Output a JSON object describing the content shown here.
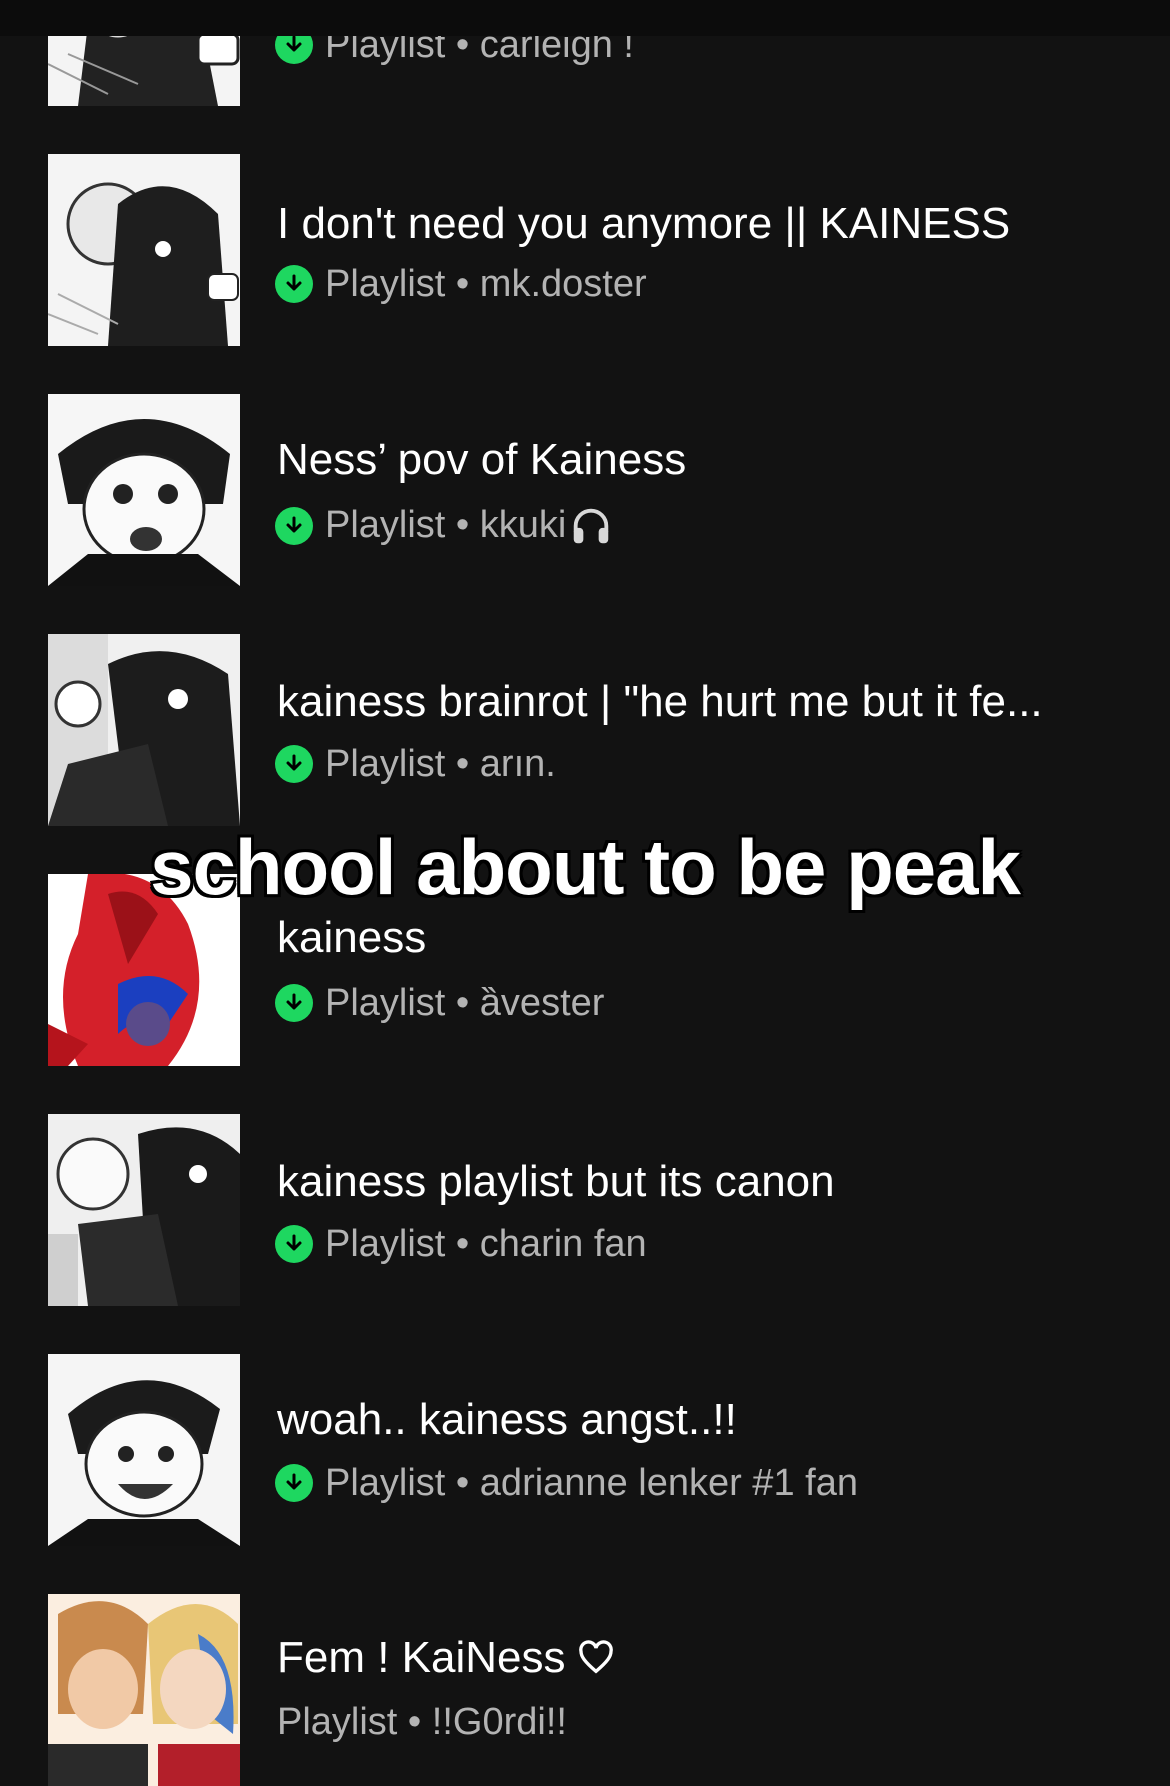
{
  "overlay_caption": "school about to be peak",
  "accent_color": "#1ed760",
  "download_icon": "download-circle-icon",
  "playlists": [
    {
      "title": "",
      "type": "Playlist",
      "owner": "carleigh !",
      "downloaded": true
    },
    {
      "title": "I don't need you anymore || KAINESS",
      "type": "Playlist",
      "owner": "mk.doster",
      "downloaded": true
    },
    {
      "title": "Ness’ pov of Kainess",
      "type": "Playlist",
      "owner": "kkuki",
      "owner_icon": "headphones-icon",
      "downloaded": true
    },
    {
      "title": "kainess brainrot | \"he hurt me but it fe...",
      "type": "Playlist",
      "owner": "arın.",
      "downloaded": true
    },
    {
      "title": "kainess",
      "type": "Playlist",
      "owner": "ȁvester",
      "downloaded": true
    },
    {
      "title": "kainess playlist but its canon",
      "type": "Playlist",
      "owner": "charin fan",
      "downloaded": true
    },
    {
      "title": "woah.. kainess angst..!!",
      "type": "Playlist",
      "owner": "adrianne lenker #1 fan",
      "downloaded": true
    },
    {
      "title": "Fem ! KaiNess",
      "title_icon": "heart-icon",
      "type": "Playlist",
      "owner": "!!G0rdi!!",
      "downloaded": false
    }
  ]
}
